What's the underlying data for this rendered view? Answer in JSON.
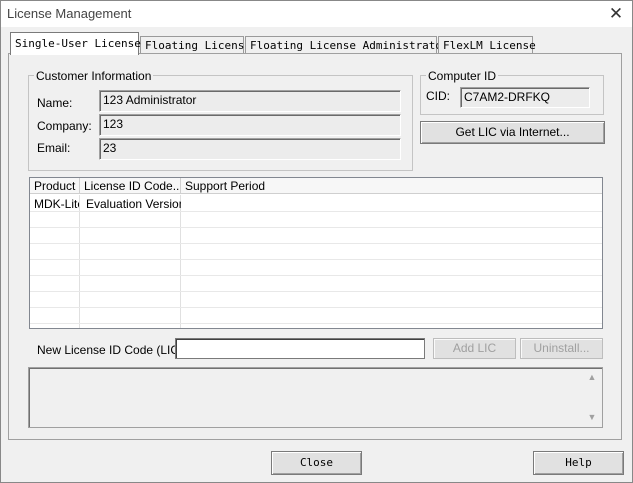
{
  "window": {
    "title": "License Management"
  },
  "tabs": [
    {
      "label": "Single-User License",
      "active": true
    },
    {
      "label": "Floating License",
      "active": false
    },
    {
      "label": "Floating License Administrator",
      "active": false
    },
    {
      "label": "FlexLM License",
      "active": false
    }
  ],
  "customer": {
    "group_label": "Customer Information",
    "name_label": "Name:",
    "name_value": "123 Administrator",
    "company_label": "Company:",
    "company_value": "123",
    "email_label": "Email:",
    "email_value": "23"
  },
  "computer": {
    "group_label": "Computer ID",
    "cid_label": "CID:",
    "cid_value": "C7AM2-DRFKQ",
    "get_lic_button": "Get LIC via Internet..."
  },
  "license_table": {
    "columns": [
      "Product",
      "License ID Code...",
      "Support Period"
    ],
    "rows": [
      [
        "MDK-Lite",
        "Evaluation Version",
        ""
      ]
    ]
  },
  "lic_entry": {
    "label": "New License ID Code (LIC):",
    "value": "",
    "add_button": "Add LIC",
    "uninstall_button": "Uninstall..."
  },
  "footer": {
    "close_button": "Close",
    "help_button": "Help"
  },
  "colors": {
    "dialog_bg": "#f0f0f0",
    "active_tab_bg": "#ffffff",
    "disabled_text": "#a0a0a0"
  }
}
